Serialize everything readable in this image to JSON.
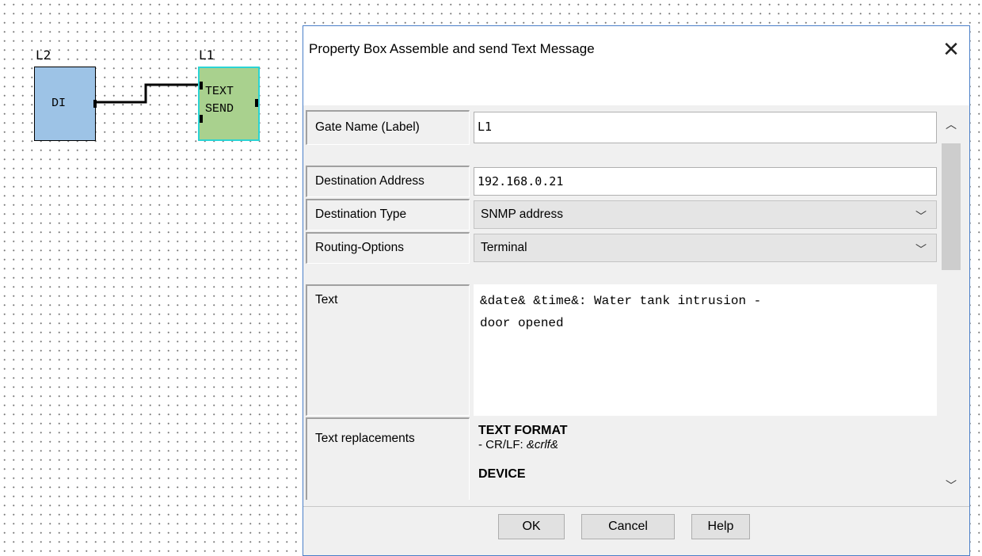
{
  "canvas": {
    "gate_l2": {
      "label": "L2",
      "text": "DI",
      "color": "#9dc3e6"
    },
    "gate_l1": {
      "label": "L1",
      "text_line1": "TEXT",
      "text_line2": "SEND",
      "color": "#a9d18e",
      "selected_border": "#2bd4d4"
    }
  },
  "dialog": {
    "title": "Property Box Assemble and send Text Message",
    "close_icon": "close-icon",
    "fields": {
      "gate_name": {
        "label": "Gate Name (Label)",
        "value": "L1"
      },
      "destination_address": {
        "label": "Destination Address",
        "value": "192.168.0.21"
      },
      "destination_type": {
        "label": "Destination Type",
        "value": "SNMP address"
      },
      "routing_options": {
        "label": "Routing-Options",
        "value": "Terminal"
      },
      "text": {
        "label": "Text",
        "line1": "&date& &time&: Water tank intrusion -",
        "line2": "door opened"
      },
      "text_replacements": {
        "label": "Text replacements",
        "heading1": "TEXT FORMAT",
        "item1_prefix": "- CR/LF: ",
        "item1_code": "&crlf&",
        "heading2": "DEVICE"
      }
    },
    "buttons": {
      "ok": "OK",
      "cancel": "Cancel",
      "help": "Help"
    },
    "scroll_icons": {
      "up": "chevron-up-icon",
      "down": "chevron-down-icon"
    }
  }
}
